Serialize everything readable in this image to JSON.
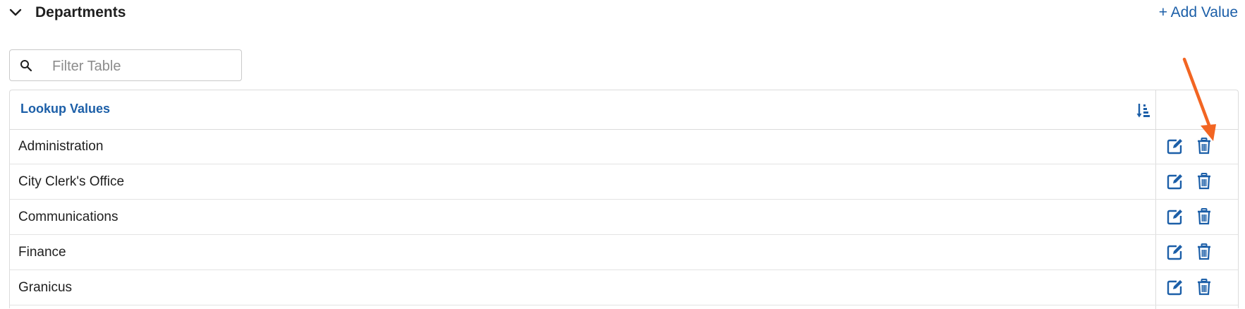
{
  "section": {
    "title": "Departments",
    "add_value_label": "+ Add Value"
  },
  "filter": {
    "placeholder": "Filter Table"
  },
  "table": {
    "column_header": "Lookup Values",
    "rows": [
      {
        "label": "Administration"
      },
      {
        "label": "City Clerk's Office"
      },
      {
        "label": "Communications"
      },
      {
        "label": "Finance"
      },
      {
        "label": "Granicus"
      }
    ]
  },
  "colors": {
    "accent": "#1c5fa8",
    "annotation": "#f26522"
  },
  "icons": [
    "chevron-down-icon",
    "search-icon",
    "sort-icon",
    "edit-icon",
    "trash-icon",
    "annotation-arrow"
  ]
}
